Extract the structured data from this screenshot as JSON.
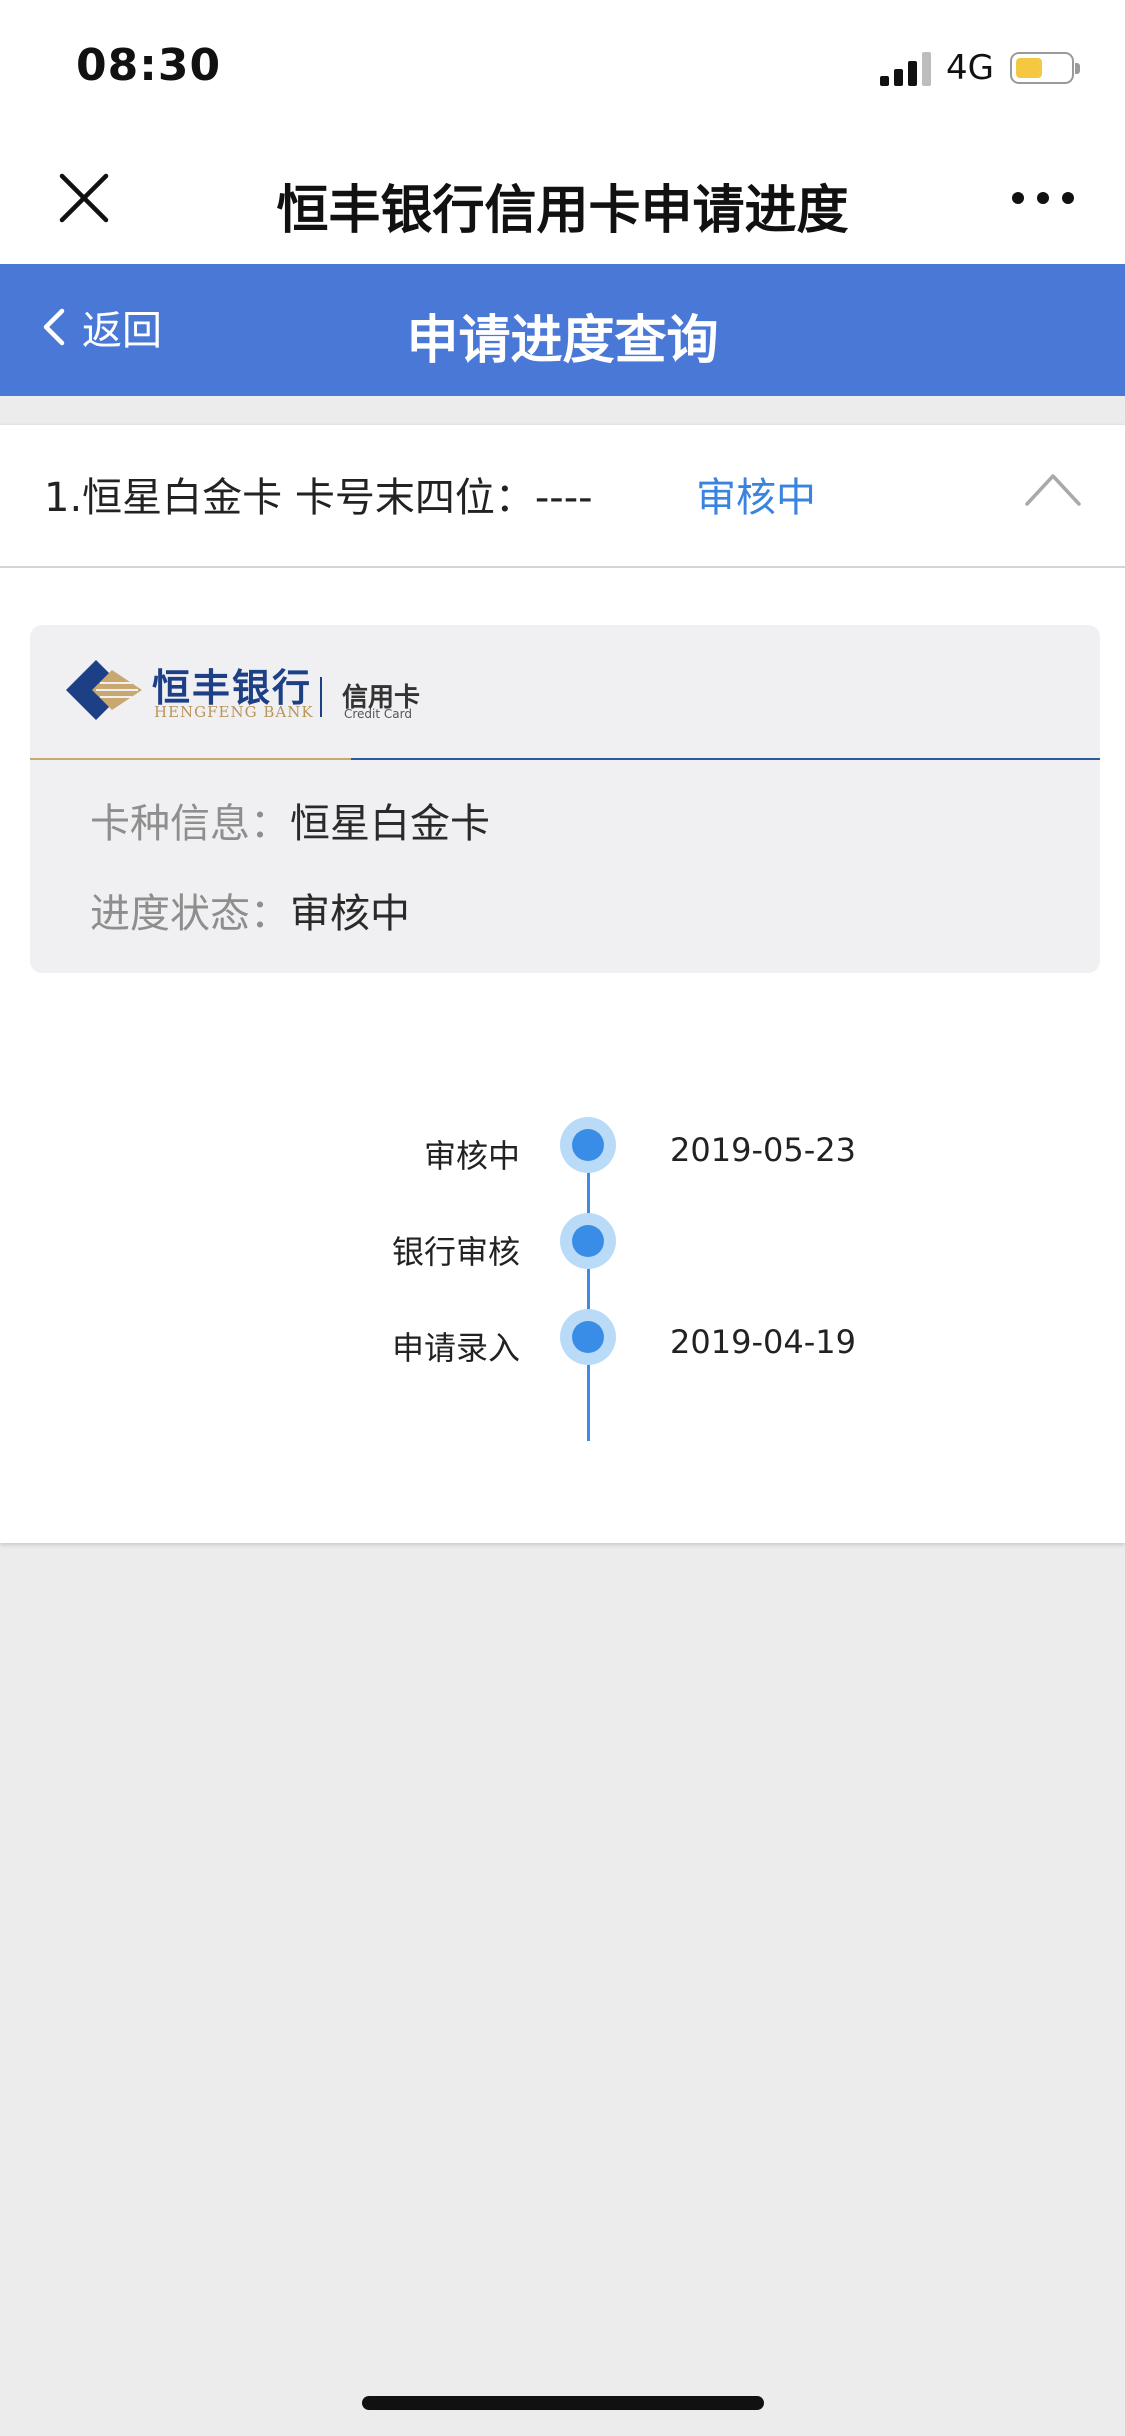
{
  "status_bar": {
    "time": "08:30",
    "network": "4G",
    "icons": [
      "signal-icon",
      "battery-icon"
    ],
    "battery_color": "#f5c842"
  },
  "navbar": {
    "title": "恒丰银行信用卡申请进度",
    "icons": [
      "close-icon",
      "more-icon"
    ]
  },
  "header": {
    "back_label": "返回",
    "title": "申请进度查询",
    "color": "#4a78d6",
    "icons": [
      "chevron-left-icon"
    ]
  },
  "application": {
    "summary": "1.恒星白金卡 卡号末四位：----",
    "status": "审核中",
    "status_color": "#3a84e0",
    "icons": [
      "chevron-up-icon"
    ]
  },
  "card_info": {
    "logo": {
      "bank_cn": "恒丰银行",
      "bank_en": "HENGFENG BANK",
      "card_cn": "信用卡",
      "card_en": "Credit Card"
    },
    "rows": [
      {
        "label": "卡种信息：",
        "value": "恒星白金卡"
      },
      {
        "label": "进度状态：",
        "value": "审核中"
      }
    ]
  },
  "timeline": [
    {
      "label": "审核中",
      "date": "2019-05-23"
    },
    {
      "label": "银行审核",
      "date": ""
    },
    {
      "label": "申请录入",
      "date": "2019-04-19"
    }
  ],
  "colors": {
    "accent": "#3a8de6",
    "background": "#ececec"
  }
}
